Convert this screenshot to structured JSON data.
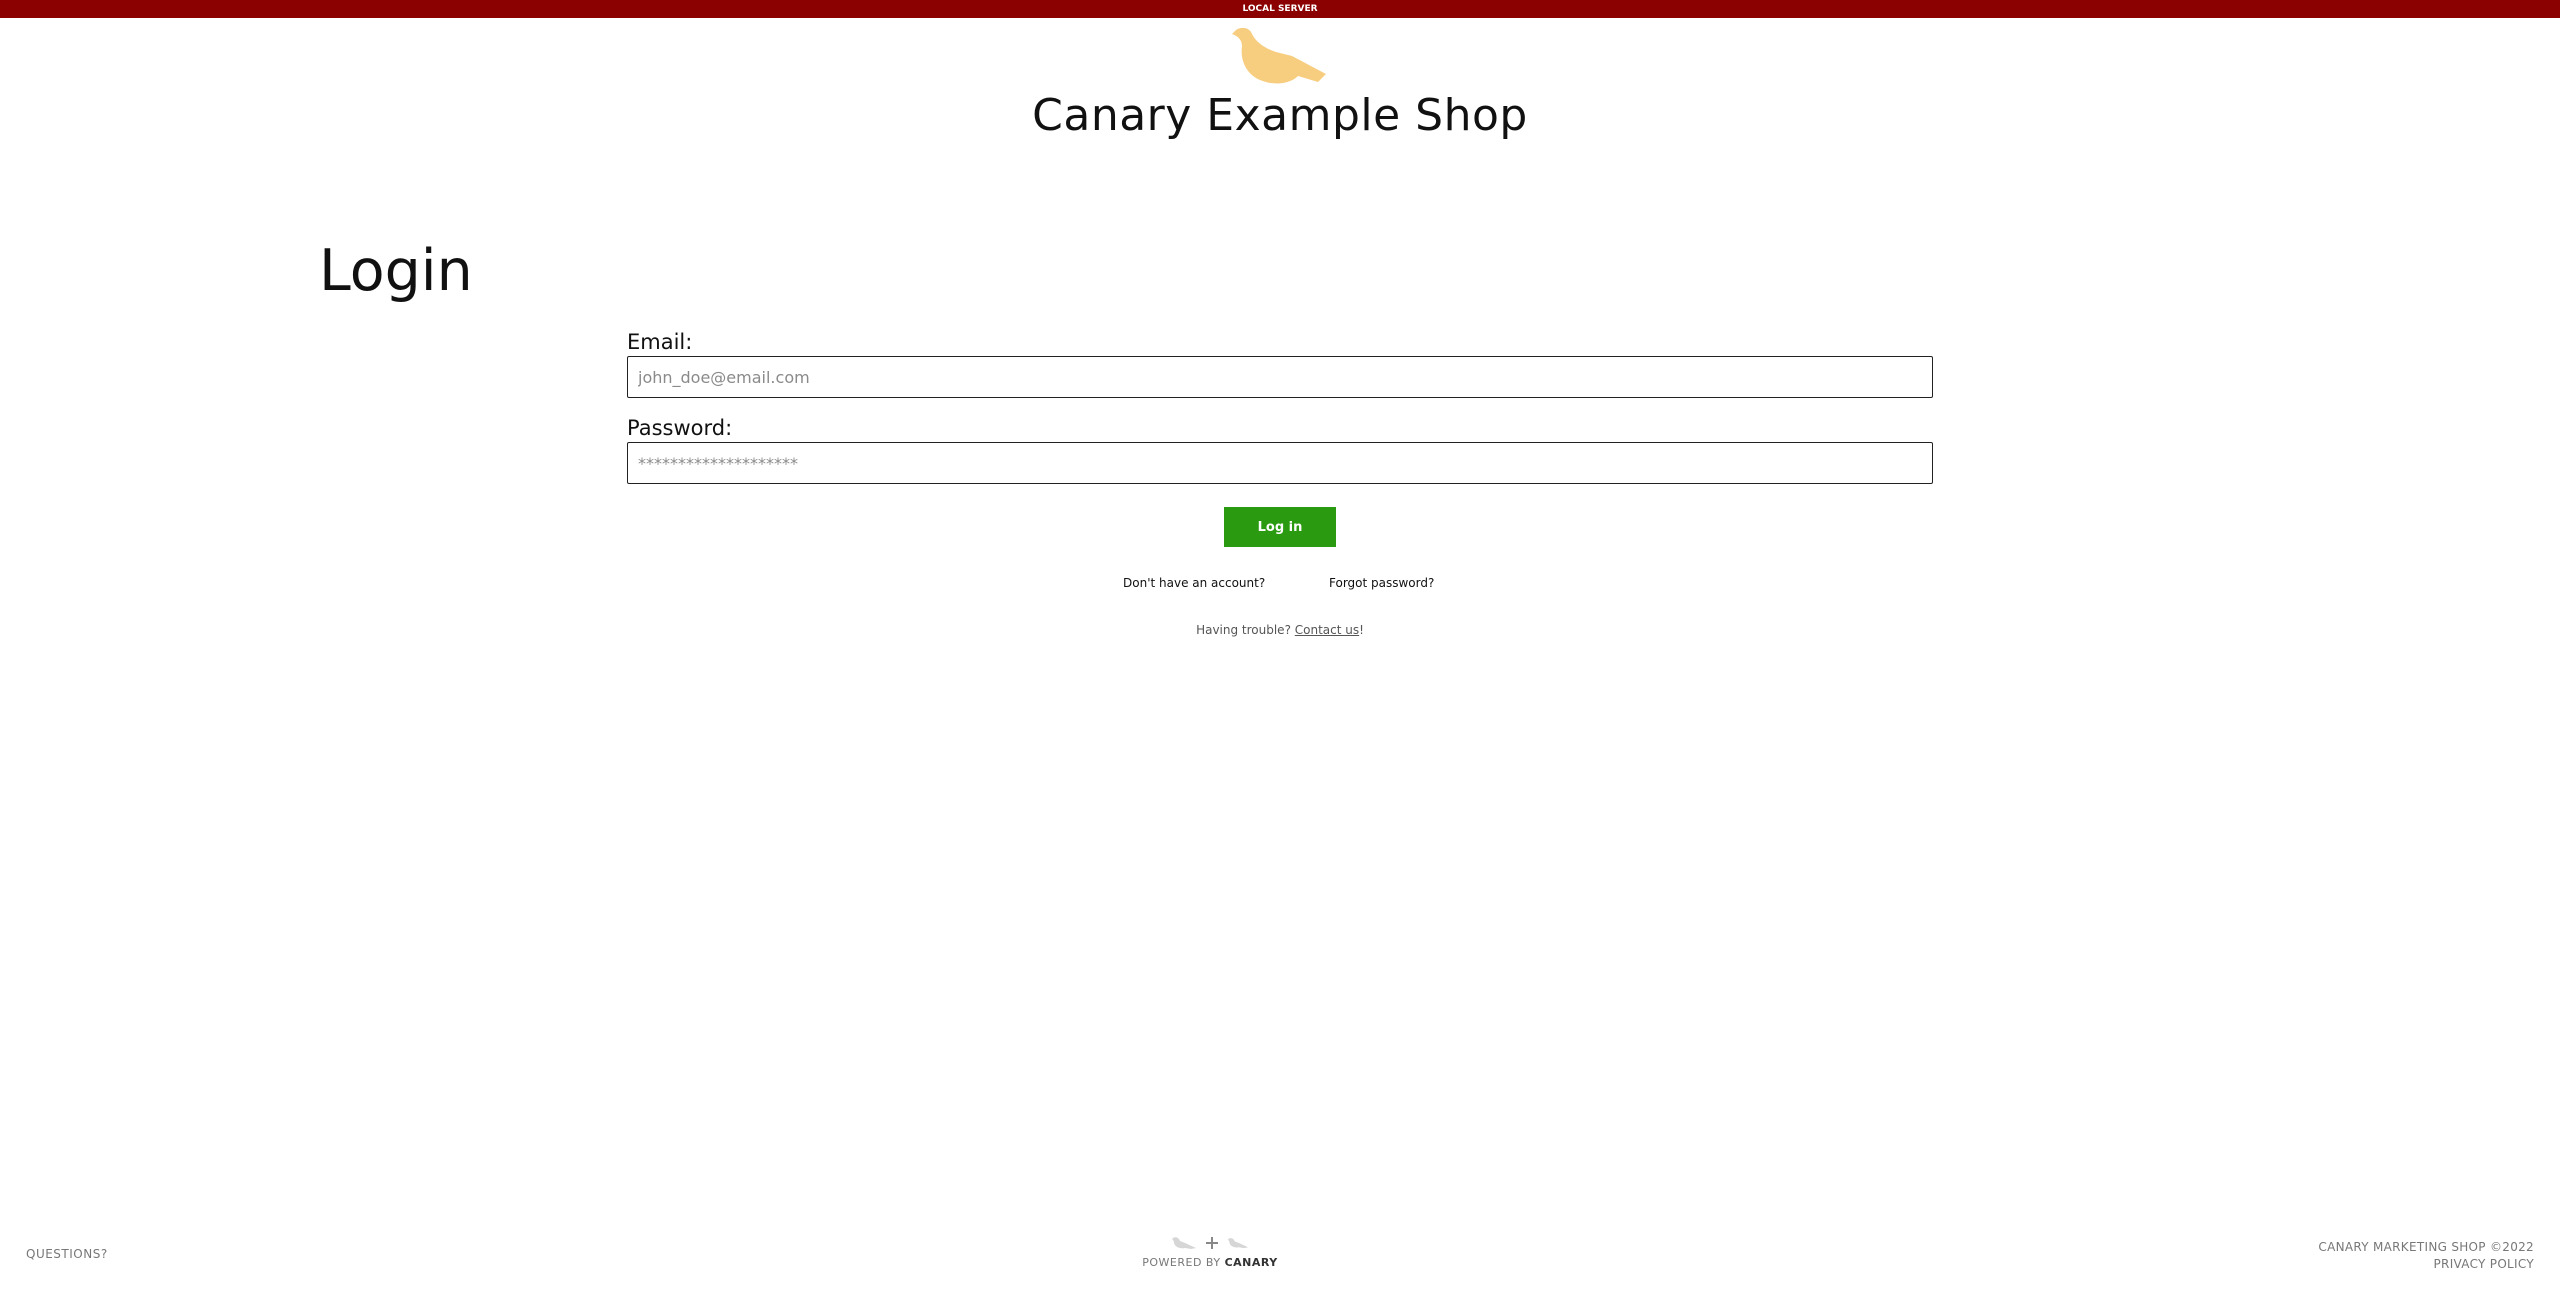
{
  "banner": {
    "text": "LOCAL SERVER",
    "color": "#8b0000"
  },
  "brand": {
    "logo_icon": "canary-bird-icon",
    "logo_color": "#f7cd7f",
    "title": "Canary Example Shop"
  },
  "page": {
    "heading": "Login"
  },
  "form": {
    "email": {
      "label": "Email:",
      "placeholder": "john_doe@email.com",
      "value": ""
    },
    "password": {
      "label": "Password:",
      "placeholder": "********************",
      "value": ""
    },
    "submit_label": "Log in",
    "submit_color": "#2a9a10"
  },
  "links": {
    "no_account": "Don't have an account?",
    "forgot_password": "Forgot password?"
  },
  "help": {
    "prefix": "Having trouble? ",
    "link": "Contact us",
    "suffix": "!"
  },
  "footer": {
    "left": "QUESTIONS?",
    "center_prefix": "POWERED BY ",
    "center_brand": "CANARY",
    "center_icons": [
      "bird-icon",
      "plus-icon",
      "bird-icon"
    ],
    "right_line1": "CANARY MARKETING SHOP ©2022",
    "right_line2": "PRIVACY POLICY"
  }
}
